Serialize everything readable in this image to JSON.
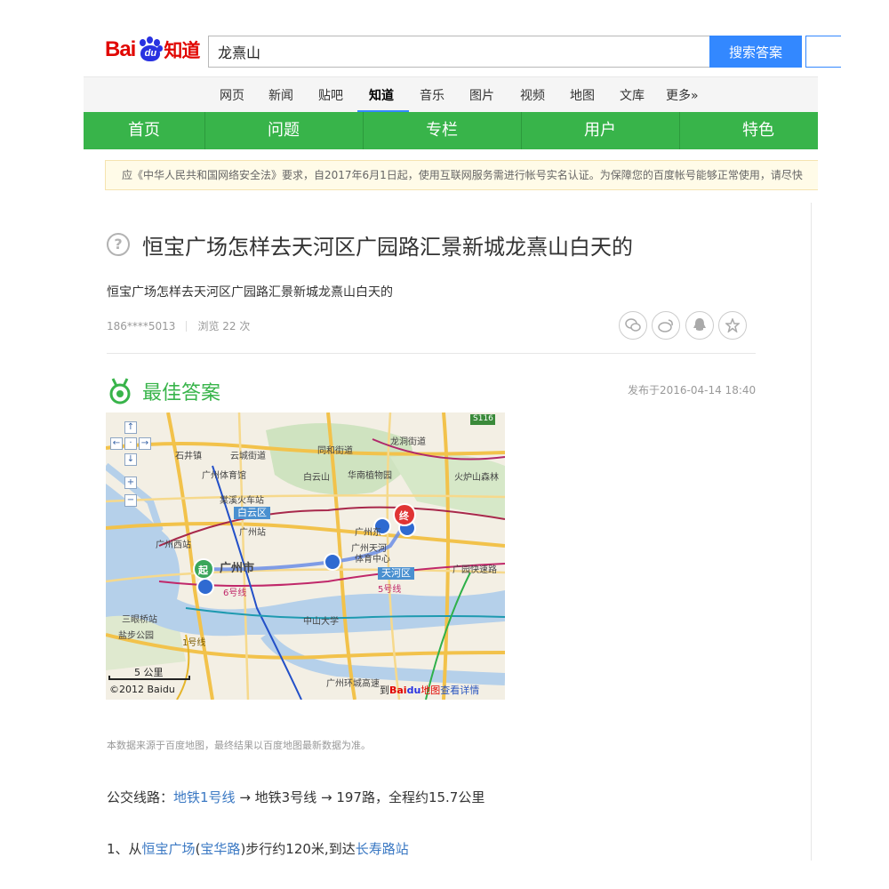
{
  "header": {
    "logo_bai": "Bai",
    "logo_du": "du",
    "logo_zhidao": "知道",
    "search_value": "龙熹山",
    "search_button": "搜索答案"
  },
  "nav": {
    "items": [
      "网页",
      "新闻",
      "贴吧",
      "知道",
      "音乐",
      "图片",
      "视频",
      "地图",
      "文库",
      "更多»"
    ],
    "active_index": 3
  },
  "menu": {
    "items": [
      "首页",
      "问题",
      "专栏",
      "用户",
      "特色"
    ]
  },
  "notice": "应《中华人民共和国网络安全法》要求，自2017年6月1日起，使用互联网服务需进行帐号实名认证。为保障您的百度帐号能够正常使用，请尽快",
  "question": {
    "title": "恒宝广场怎样去天河区广园路汇景新城龙熹山白天的",
    "description": "恒宝广场怎样去天河区广园路汇景新城龙熹山白天的",
    "user": "186****5013",
    "views": "浏览 22 次"
  },
  "answer": {
    "heading": "最佳答案",
    "published": "发布于2016-04-14 18:40",
    "map": {
      "labels": [
        "石井镇",
        "云城街道",
        "同和街道",
        "龙洞街道",
        "广州体育馆",
        "白云山",
        "华南植物园",
        "火炉山森林",
        "棠溪火车站",
        "广州站",
        "广州西站",
        "广州市",
        "广州东",
        "广州天河",
        "体育中心",
        "中山大学",
        "三眼桥站",
        "盐步公园",
        "广园快速路",
        "广州环城高速",
        "6号线",
        "5号线",
        "1号线"
      ],
      "district_labels": [
        "白云区",
        "天河区"
      ],
      "start_marker": "起",
      "end_marker": "终",
      "road_badge": "S116",
      "scale": "5 公里",
      "copyright": "©2012 Baidu",
      "detail_prefix": "到",
      "detail_brand_bai": "Bai",
      "detail_brand_du": "du",
      "detail_map": "地图",
      "detail_link": "查看详情"
    },
    "source_note": "本数据来源于百度地图，最终结果以百度地图最新数据为准。",
    "route": {
      "prefix": "公交线路：",
      "line1": "地铁1号线",
      "arrow1": " → 地铁3号线 → 197路，全程约15.7公里"
    },
    "step1": {
      "num": "1、从",
      "from": "恒宝广场",
      "paren_open": "(",
      "street": "宝华路",
      "paren_close": ")",
      "mid": "步行约120米,到达",
      "to": "长寿路站"
    }
  },
  "colors": {
    "brand_red": "#e10601",
    "brand_blue": "#2932e1",
    "green": "#38b44a",
    "link_blue": "#3a78c3",
    "search_blue": "#3388ff"
  }
}
